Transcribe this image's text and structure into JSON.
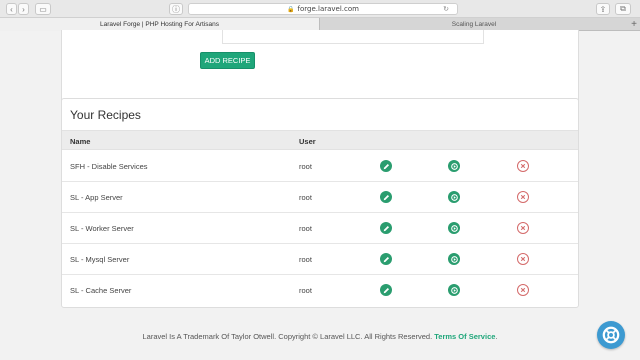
{
  "browser": {
    "url": "forge.laravel.com",
    "tabs": [
      {
        "label": "Laravel Forge | PHP Hosting For Artisans"
      },
      {
        "label": "Scaling Laravel"
      }
    ],
    "new_tab": "+"
  },
  "form": {
    "add_button": "ADD RECIPE"
  },
  "recipes": {
    "title": "Your Recipes",
    "columns": [
      "Name",
      "User"
    ],
    "rows": [
      {
        "name": "SFH - Disable Services",
        "user": "root"
      },
      {
        "name": "SL - App Server",
        "user": "root"
      },
      {
        "name": "SL - Worker Server",
        "user": "root"
      },
      {
        "name": "SL - Mysql Server",
        "user": "root"
      },
      {
        "name": "SL - Cache Server",
        "user": "root"
      }
    ],
    "row_icons": [
      "pencil-icon",
      "play-icon",
      "close-icon"
    ]
  },
  "footer": {
    "text": "Laravel Is A Trademark Of Taylor Otwell. Copyright © Laravel LLC. All Rights Reserved.",
    "link": "Terms Of Service",
    "end": "."
  },
  "colors": {
    "accent": "#1fa67a",
    "delete": "#d46a6a",
    "help": "#3d9ad1"
  }
}
